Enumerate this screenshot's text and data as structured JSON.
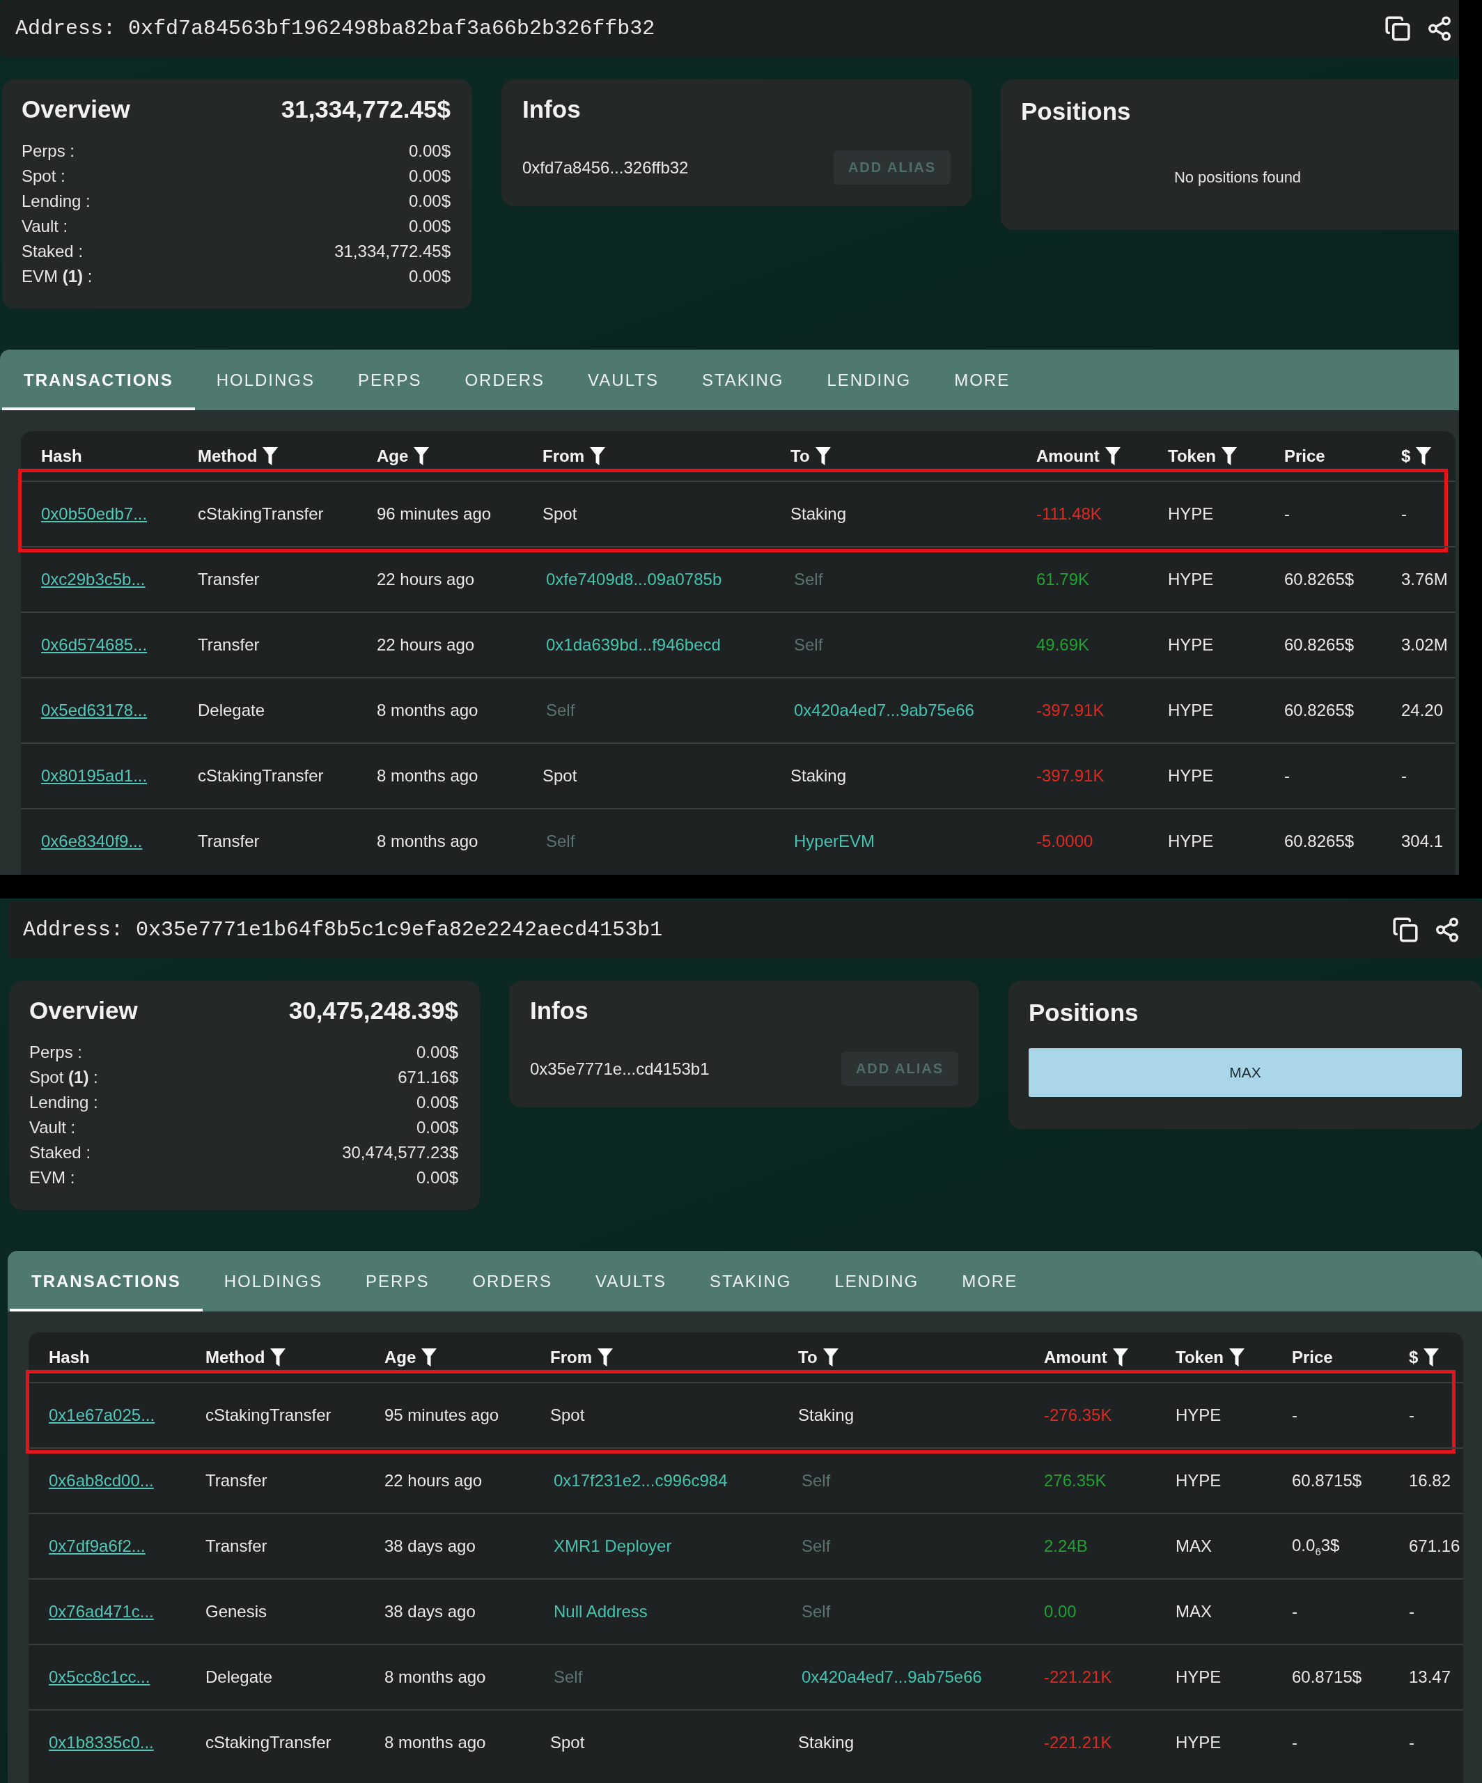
{
  "frames": [
    {
      "address": "Address: 0xfd7a84563bf1962498ba82baf3a66b2b326ffb32",
      "overview": {
        "title": "Overview",
        "total": "31,334,772.45$",
        "rows": [
          {
            "label": "Perps :",
            "value": "0.00$"
          },
          {
            "label": "Spot :",
            "value": "0.00$"
          },
          {
            "label": "Lending :",
            "value": "0.00$"
          },
          {
            "label": "Vault :",
            "value": "0.00$"
          },
          {
            "label": "Staked :",
            "value": "31,334,772.45$"
          },
          {
            "label": "EVM **(1)** :",
            "value": "0.00$"
          }
        ]
      },
      "infos": {
        "title": "Infos",
        "address": "0xfd7a8456...326ffb32",
        "button": {
          "label": "ADD ALIAS",
          "disabled": true
        }
      },
      "positions": {
        "title": "Positions",
        "empty_message": "No positions found"
      },
      "tabs": [
        {
          "label": "TRANSACTIONS",
          "selected": true
        },
        {
          "label": "HOLDINGS",
          "selected": false
        },
        {
          "label": "PERPS",
          "selected": false
        },
        {
          "label": "ORDERS",
          "selected": false
        },
        {
          "label": "VAULTS",
          "selected": false
        },
        {
          "label": "STAKING",
          "selected": false
        },
        {
          "label": "LENDING",
          "selected": false
        },
        {
          "label": "MORE",
          "selected": false
        }
      ],
      "table": {
        "columns": [
          {
            "label": "Hash",
            "filter": false
          },
          {
            "label": "Method",
            "filter": true
          },
          {
            "label": "Age",
            "filter": true
          },
          {
            "label": "From",
            "filter": true
          },
          {
            "label": "To",
            "filter": true
          },
          {
            "label": "Amount",
            "filter": true
          },
          {
            "label": "Token",
            "filter": true
          },
          {
            "label": "Price",
            "filter": false
          },
          {
            "label": "$",
            "filter": true
          }
        ],
        "rows": [
          {
            "highlighted": true,
            "hash": "0x0b50edb7...",
            "method": "cStakingTransfer",
            "age": "96 minutes ago",
            "from": {
              "kind": "plain",
              "text": "Spot"
            },
            "to": {
              "kind": "plain",
              "text": "Staking"
            },
            "amount": {
              "text": "-111.48K",
              "color": "#dc2a22"
            },
            "token": "HYPE",
            "price": "-",
            "usd": "-"
          },
          {
            "highlighted": false,
            "hash": "0xc29b3c5b...",
            "method": "Transfer",
            "age": "22 hours ago",
            "from": {
              "kind": "link",
              "text": "0xfe7409d8...09a0785b"
            },
            "to": {
              "kind": "self",
              "text": "Self"
            },
            "amount": {
              "text": "61.79K",
              "color": "#22a033"
            },
            "token": "HYPE",
            "price": "60.8265$",
            "usd": "3.76M"
          },
          {
            "highlighted": false,
            "hash": "0x6d574685...",
            "method": "Transfer",
            "age": "22 hours ago",
            "from": {
              "kind": "link",
              "text": "0x1da639bd...f946becd"
            },
            "to": {
              "kind": "self",
              "text": "Self"
            },
            "amount": {
              "text": "49.69K",
              "color": "#22a033"
            },
            "token": "HYPE",
            "price": "60.8265$",
            "usd": "3.02M"
          },
          {
            "highlighted": false,
            "hash": "0x5ed63178...",
            "method": "Delegate",
            "age": "8 months ago",
            "from": {
              "kind": "self",
              "text": "Self"
            },
            "to": {
              "kind": "link",
              "text": "0x420a4ed7...9ab75e66"
            },
            "amount": {
              "text": "-397.91K",
              "color": "#dc2a22"
            },
            "token": "HYPE",
            "price": "60.8265$",
            "usd": "24.20"
          },
          {
            "highlighted": false,
            "hash": "0x80195ad1...",
            "method": "cStakingTransfer",
            "age": "8 months ago",
            "from": {
              "kind": "plain",
              "text": "Spot"
            },
            "to": {
              "kind": "plain",
              "text": "Staking"
            },
            "amount": {
              "text": "-397.91K",
              "color": "#dc2a22"
            },
            "token": "HYPE",
            "price": "-",
            "usd": "-"
          },
          {
            "highlighted": false,
            "hash": "0x6e8340f9...",
            "method": "Transfer",
            "age": "8 months ago",
            "from": {
              "kind": "self",
              "text": "Self"
            },
            "to": {
              "kind": "link",
              "text": "HyperEVM"
            },
            "amount": {
              "text": "-5.0000",
              "color": "#dc2a22"
            },
            "token": "HYPE",
            "price": "60.8265$",
            "usd": "304.1"
          }
        ]
      }
    },
    {
      "address": "Address: 0x35e7771e1b64f8b5c1c9efa82e2242aecd4153b1",
      "overview": {
        "title": "Overview",
        "total": "30,475,248.39$",
        "rows": [
          {
            "label": "Perps :",
            "value": "0.00$"
          },
          {
            "label": "Spot **(1)** :",
            "value": "671.16$"
          },
          {
            "label": "Lending :",
            "value": "0.00$"
          },
          {
            "label": "Vault :",
            "value": "0.00$"
          },
          {
            "label": "Staked :",
            "value": "30,474,577.23$"
          },
          {
            "label": "EVM :",
            "value": "0.00$"
          }
        ]
      },
      "infos": {
        "title": "Infos",
        "address": "0x35e7771e...cd4153b1",
        "button": {
          "label": "ADD ALIAS",
          "disabled": true
        }
      },
      "positions": {
        "title": "Positions",
        "items": [
          {
            "label": "MAX"
          }
        ]
      },
      "tabs": [
        {
          "label": "TRANSACTIONS",
          "selected": true
        },
        {
          "label": "HOLDINGS",
          "selected": false
        },
        {
          "label": "PERPS",
          "selected": false
        },
        {
          "label": "ORDERS",
          "selected": false
        },
        {
          "label": "VAULTS",
          "selected": false
        },
        {
          "label": "STAKING",
          "selected": false
        },
        {
          "label": "LENDING",
          "selected": false
        },
        {
          "label": "MORE",
          "selected": false
        }
      ],
      "table": {
        "columns": [
          {
            "label": "Hash",
            "filter": false
          },
          {
            "label": "Method",
            "filter": true
          },
          {
            "label": "Age",
            "filter": true
          },
          {
            "label": "From",
            "filter": true
          },
          {
            "label": "To",
            "filter": true
          },
          {
            "label": "Amount",
            "filter": true
          },
          {
            "label": "Token",
            "filter": true
          },
          {
            "label": "Price",
            "filter": false
          },
          {
            "label": "$",
            "filter": true
          }
        ],
        "rows": [
          {
            "highlighted": true,
            "hash": "0x1e67a025...",
            "method": "cStakingTransfer",
            "age": "95 minutes ago",
            "from": {
              "kind": "plain",
              "text": "Spot"
            },
            "to": {
              "kind": "plain",
              "text": "Staking"
            },
            "amount": {
              "text": "-276.35K",
              "color": "#dc2a22"
            },
            "token": "HYPE",
            "price": "-",
            "usd": "-"
          },
          {
            "highlighted": false,
            "hash": "0x6ab8cd00...",
            "method": "Transfer",
            "age": "22 hours ago",
            "from": {
              "kind": "link",
              "text": "0x17f231e2...c996c984"
            },
            "to": {
              "kind": "self",
              "text": "Self"
            },
            "amount": {
              "text": "276.35K",
              "color": "#22a033"
            },
            "token": "HYPE",
            "price": "60.8715$",
            "usd": "16.82"
          },
          {
            "highlighted": false,
            "hash": "0x7df9a6f2...",
            "method": "Transfer",
            "age": "38 days ago",
            "from": {
              "kind": "link",
              "text": "XMR1 Deployer"
            },
            "to": {
              "kind": "self",
              "text": "Self"
            },
            "amount": {
              "text": "2.24B",
              "color": "#22a033"
            },
            "token": "MAX",
            "price": "0.0$_{6}$3$",
            "usd": "671.16"
          },
          {
            "highlighted": false,
            "hash": "0x76ad471c...",
            "method": "Genesis",
            "age": "38 days ago",
            "from": {
              "kind": "link",
              "text": "Null Address"
            },
            "to": {
              "kind": "self",
              "text": "Self"
            },
            "amount": {
              "text": "0.00",
              "color": "#22a033"
            },
            "token": "MAX",
            "price": "-",
            "usd": "-"
          },
          {
            "highlighted": false,
            "hash": "0x5cc8c1cc...",
            "method": "Delegate",
            "age": "8 months ago",
            "from": {
              "kind": "self",
              "text": "Self"
            },
            "to": {
              "kind": "link",
              "text": "0x420a4ed7...9ab75e66"
            },
            "amount": {
              "text": "-221.21K",
              "color": "#dc2a22"
            },
            "token": "HYPE",
            "price": "60.8715$",
            "usd": "13.47"
          },
          {
            "highlighted": false,
            "hash": "0x1b8335c0...",
            "method": "cStakingTransfer",
            "age": "8 months ago",
            "from": {
              "kind": "plain",
              "text": "Spot"
            },
            "to": {
              "kind": "plain",
              "text": "Staking"
            },
            "amount": {
              "text": "-221.21K",
              "color": "#dc2a22"
            },
            "token": "HYPE",
            "price": "-",
            "usd": "-"
          }
        ]
      }
    }
  ]
}
